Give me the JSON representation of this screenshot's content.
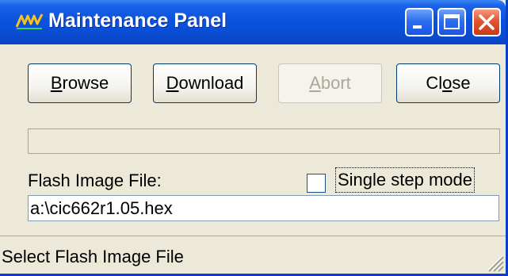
{
  "window": {
    "title": "Maintenance Panel",
    "title_bar_color": "#0a4ed6",
    "close_button_color": "#e2552f"
  },
  "buttons": {
    "browse": {
      "pre": "",
      "accel": "B",
      "post": "rowse",
      "enabled": true
    },
    "download": {
      "pre": "",
      "accel": "D",
      "post": "ownload",
      "enabled": true
    },
    "abort": {
      "pre": "",
      "accel": "A",
      "post": "bort",
      "enabled": false
    },
    "close": {
      "pre": "Cl",
      "accel": "o",
      "post": "se",
      "enabled": true
    }
  },
  "progress": {
    "value": 0
  },
  "flash": {
    "label": "Flash Image File:",
    "value": "a:\\cic662r1.05.hex"
  },
  "single_step": {
    "label": "Single step mode",
    "checked": false
  },
  "status": {
    "text": "Select Flash Image File"
  },
  "icons": {
    "app": "app-logo-icon",
    "minimize": "minimize-icon",
    "maximize": "maximize-icon",
    "close": "close-icon",
    "grip": "resize-grip-icon"
  }
}
